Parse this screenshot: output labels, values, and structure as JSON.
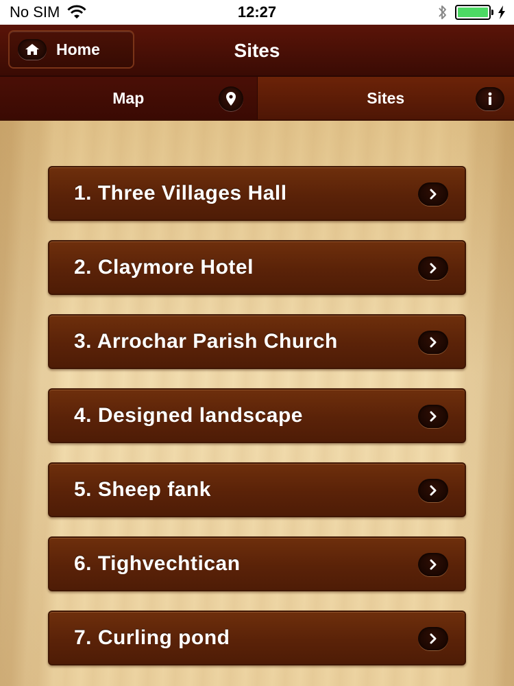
{
  "status_bar": {
    "carrier": "No SIM",
    "time": "12:27",
    "icons": [
      "wifi-icon",
      "bluetooth-icon",
      "battery-icon",
      "charging-bolt-icon"
    ]
  },
  "nav": {
    "home_label": "Home",
    "title": "Sites",
    "home_icon": "home-icon"
  },
  "tabs": [
    {
      "label": "Map",
      "icon": "location-pin-icon"
    },
    {
      "label": "Sites",
      "icon": "info-icon"
    }
  ],
  "sites": [
    {
      "label": "1. Three Villages Hall"
    },
    {
      "label": "2. Claymore Hotel"
    },
    {
      "label": "3. Arrochar Parish Church"
    },
    {
      "label": "4. Designed landscape"
    },
    {
      "label": "5. Sheep fank"
    },
    {
      "label": "6. Tighvechtican"
    },
    {
      "label": "7. Curling pond"
    }
  ],
  "colors": {
    "nav_background": "#4a1106",
    "button_background": "#5a2208",
    "content_background": "#ecd3a1",
    "battery_fill": "#4cd964"
  }
}
